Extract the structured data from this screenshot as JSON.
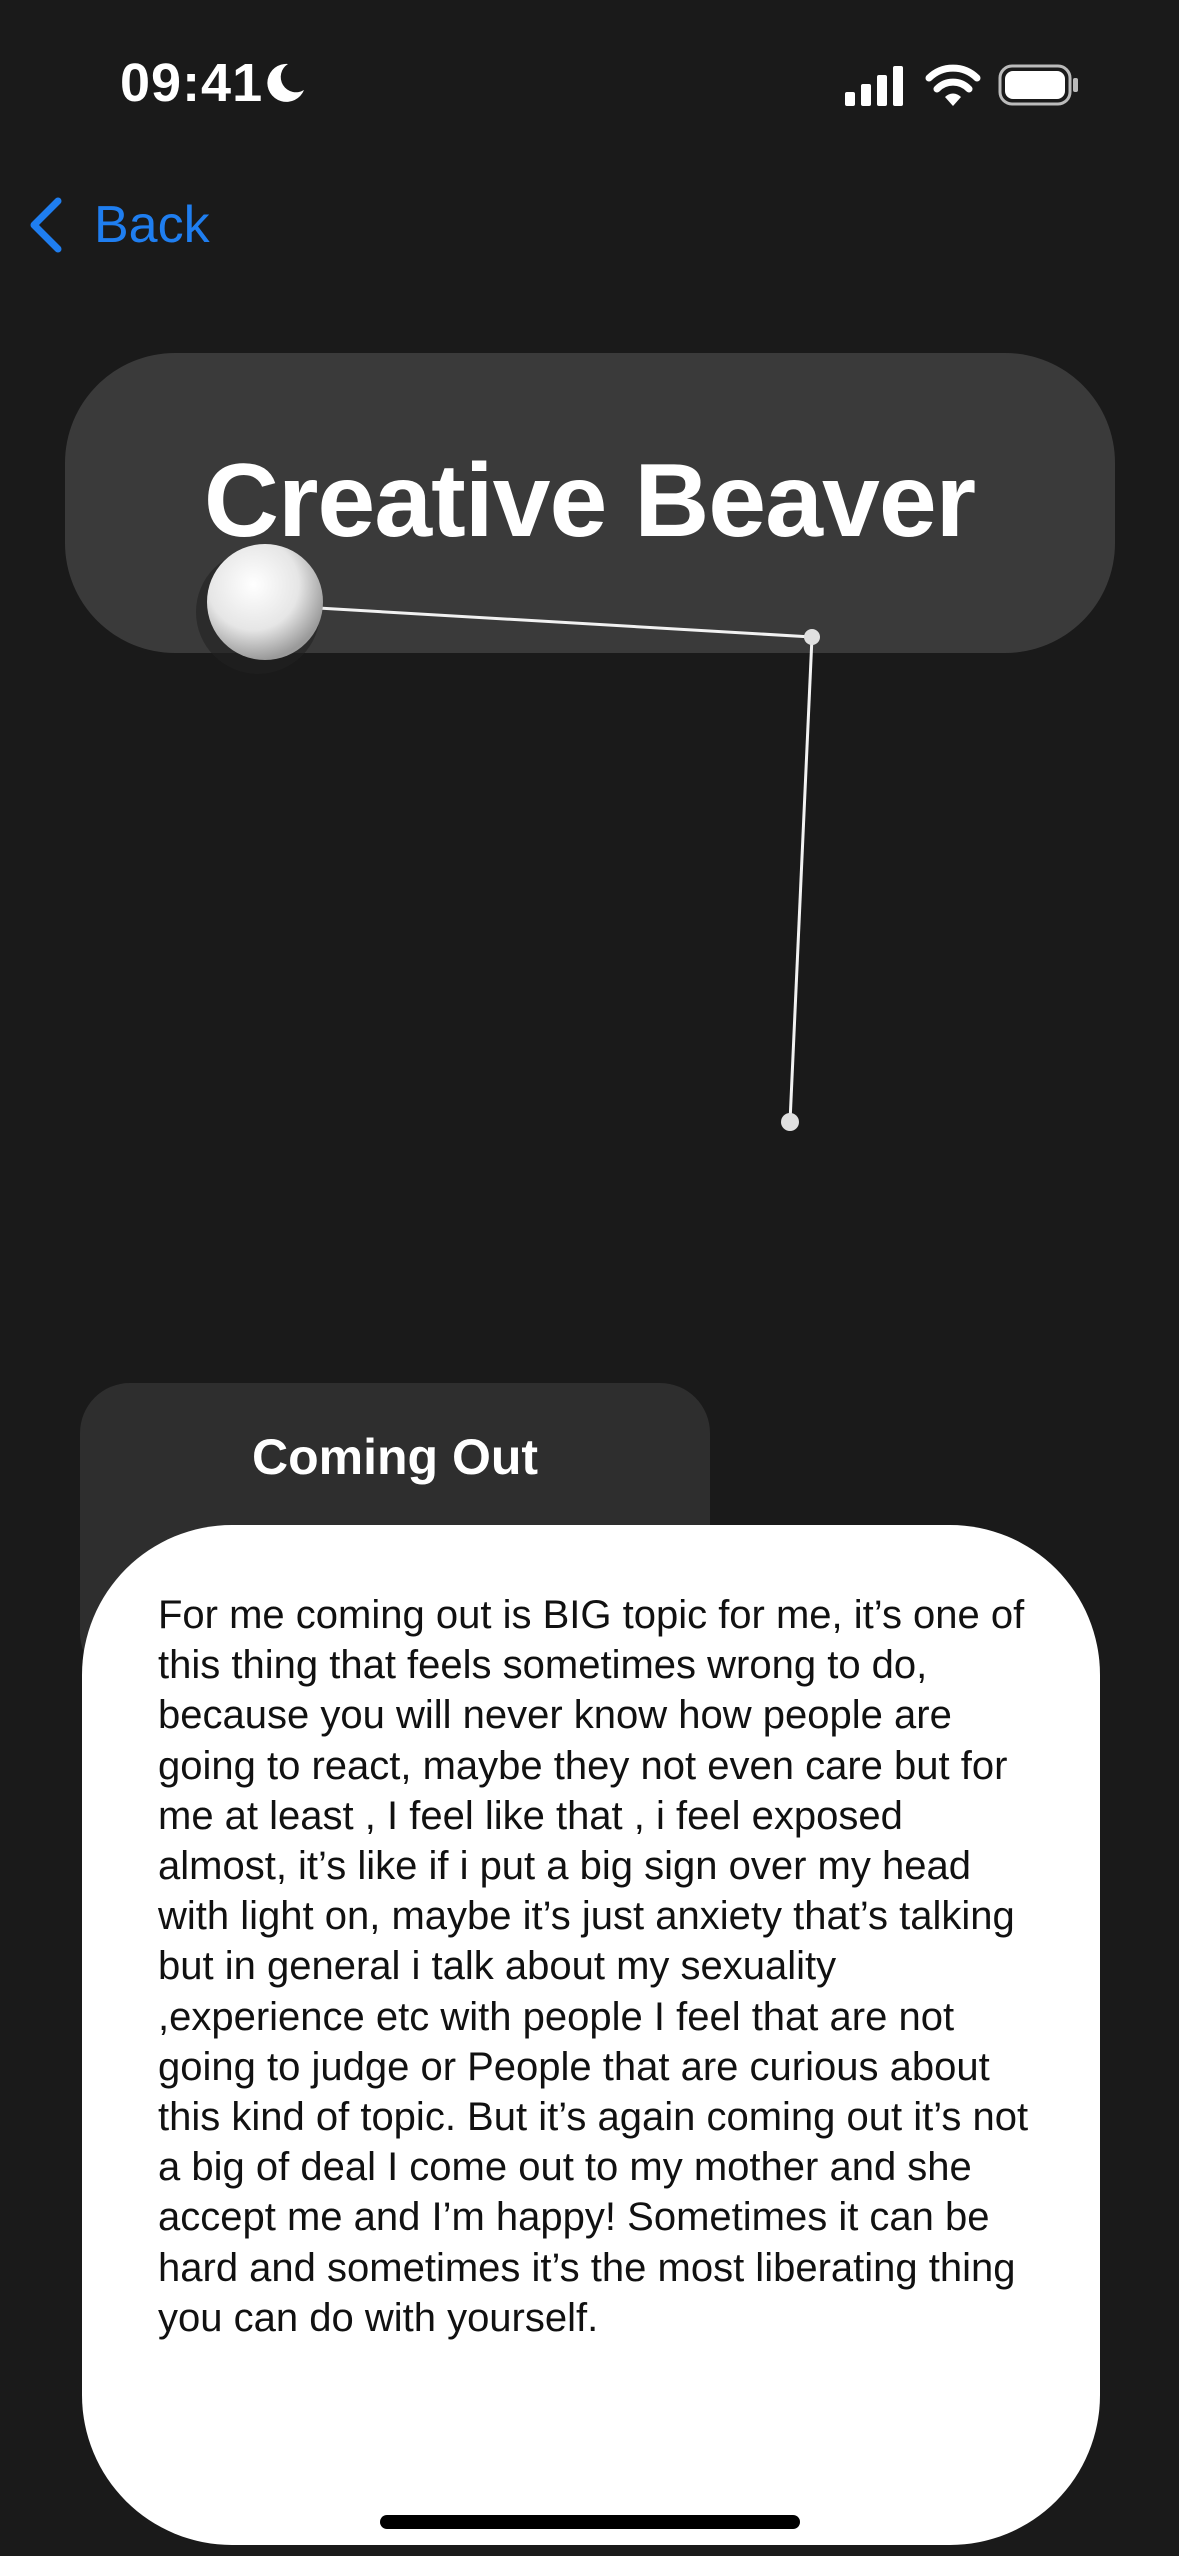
{
  "status_bar": {
    "time": "09:41",
    "icons": [
      "moon-icon",
      "cellular-signal-icon",
      "wifi-icon",
      "battery-icon"
    ]
  },
  "nav": {
    "back_label": "Back",
    "back_icon": "chevron-left-icon",
    "accent_color": "#1f7ef0"
  },
  "header": {
    "title": "Creative Beaver"
  },
  "topic": {
    "title": "Coming Out"
  },
  "story": {
    "text": "For me coming out is BIG topic for me, it’s one of this thing that feels sometimes wrong to do, because you will never know how people are going to react, maybe they not even care but for me at least , I feel like that , i feel exposed almost, it’s like if i put a big sign over my head with light on, maybe it’s just anxiety that’s talking but in general i talk about my sexuality ,experience etc with people I feel that are not going to judge or People that are curious about this kind of topic. But it’s again coming out it’s not a big of deal I come out to my mother and she accept me and I’m happy! Sometimes it can be hard and sometimes it’s the most liberating thing you can do with yourself."
  },
  "colors": {
    "background": "#1a1a1a",
    "title_card": "#3a3a3a",
    "topic_card": "#2e2e2e",
    "story_card": "#ffffff"
  }
}
